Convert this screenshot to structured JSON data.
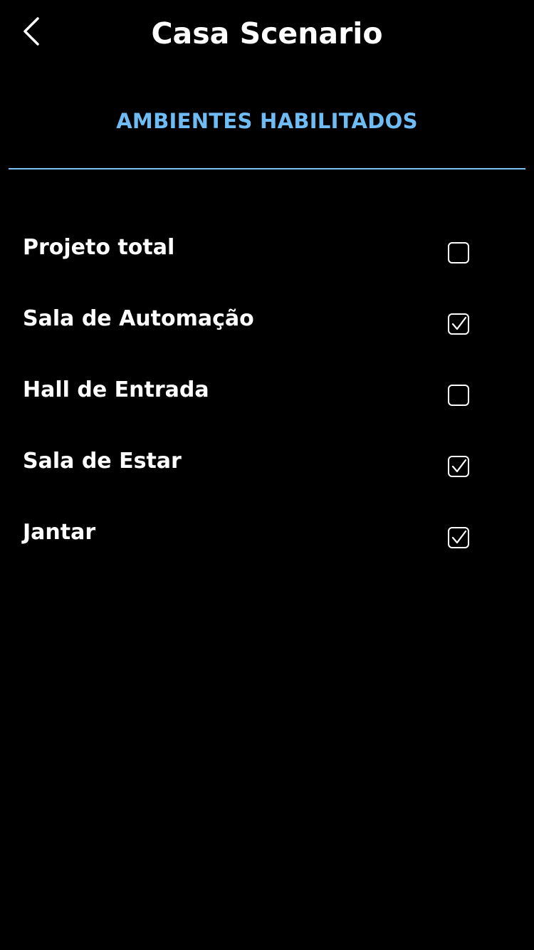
{
  "header": {
    "back_icon": "chevron-left-icon",
    "title": "Casa Scenario"
  },
  "tab": {
    "label": "AMBIENTES HABILITADOS",
    "accent_color": "#6ebcf3"
  },
  "rooms": [
    {
      "label": "Projeto total",
      "checked": false
    },
    {
      "label": "Sala de Automação",
      "checked": true
    },
    {
      "label": "Hall de Entrada",
      "checked": false
    },
    {
      "label": "Sala de Estar",
      "checked": true
    },
    {
      "label": "Jantar",
      "checked": true
    }
  ]
}
